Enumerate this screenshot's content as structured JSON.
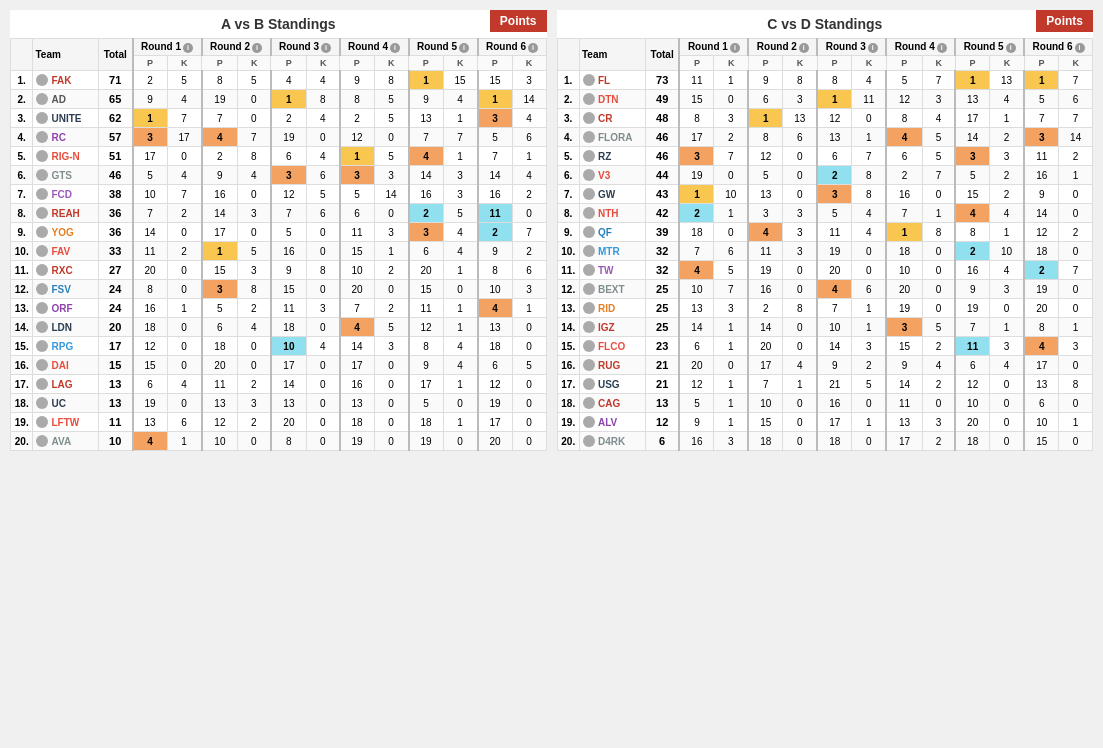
{
  "tableA": {
    "title": "A vs B Standings",
    "pointsLabel": "Points",
    "columns": {
      "rank": "#",
      "team": "Team",
      "total": "Total",
      "rounds": [
        "Round 1",
        "Round 2",
        "Round 3",
        "Round 4",
        "Round 5",
        "Round 6"
      ]
    },
    "rows": [
      {
        "rank": 1,
        "name": "FAK",
        "total": 71,
        "class": "fak",
        "r1p": 2,
        "r1k": 5,
        "r2p": 8,
        "r2k": 5,
        "r3p": 4,
        "r3k": 4,
        "r4p": 9,
        "r4k": 8,
        "r5p": 1,
        "r5k": 15,
        "r6p": 15,
        "r6k": 3,
        "highlights": {
          "r5p": "gold",
          "r5k": ""
        }
      },
      {
        "rank": 2,
        "name": "AD",
        "total": 65,
        "class": "ad",
        "r1p": 9,
        "r1k": 4,
        "r2p": 19,
        "r2k": 0,
        "r3p": 1,
        "r3k": 8,
        "r4p": 8,
        "r4k": 5,
        "r5p": 9,
        "r5k": 4,
        "r6p": 1,
        "r6k": 14,
        "highlights": {
          "r3p": "gold",
          "r6p": "gold"
        }
      },
      {
        "rank": 3,
        "name": "UNITE",
        "total": 62,
        "class": "unite",
        "r1p": 1,
        "r1k": 7,
        "r2p": 7,
        "r2k": 0,
        "r3p": 2,
        "r3k": 4,
        "r4p": 2,
        "r4k": 5,
        "r5p": 13,
        "r5k": 1,
        "r6p": 3,
        "r6k": 4,
        "highlights": {
          "r1p": "gold",
          "r6p": "orange"
        }
      },
      {
        "rank": 4,
        "name": "RC",
        "total": 57,
        "class": "rc",
        "r1p": 3,
        "r1k": 17,
        "r2p": 4,
        "r2k": 7,
        "r3p": 19,
        "r3k": 0,
        "r4p": 12,
        "r4k": 0,
        "r5p": 7,
        "r5k": 7,
        "r6p": 5,
        "r6k": 6,
        "highlights": {
          "r1p": "orange",
          "r2p": "orange"
        }
      },
      {
        "rank": 5,
        "name": "RIG-N",
        "total": 51,
        "class": "rign",
        "r1p": 17,
        "r1k": 0,
        "r2p": 2,
        "r2k": 8,
        "r3p": 6,
        "r3k": 4,
        "r4p": 1,
        "r4k": 5,
        "r5p": 4,
        "r5k": 1,
        "r6p": 7,
        "r6k": 1,
        "highlights": {
          "r4p": "gold",
          "r5p": "orange"
        }
      },
      {
        "rank": 6,
        "name": "GTS",
        "total": 46,
        "class": "gts",
        "r1p": 5,
        "r1k": 4,
        "r2p": 9,
        "r2k": 4,
        "r3p": 3,
        "r3k": 6,
        "r4p": 3,
        "r4k": 3,
        "r5p": 14,
        "r5k": 3,
        "r6p": 14,
        "r6k": 4,
        "highlights": {
          "r3p": "orange",
          "r4p": "orange"
        }
      },
      {
        "rank": 7,
        "name": "FCD",
        "total": 38,
        "class": "fcd",
        "r1p": 10,
        "r1k": 7,
        "r2p": 16,
        "r2k": 0,
        "r3p": 12,
        "r3k": 5,
        "r4p": 5,
        "r4k": 14,
        "r5p": 16,
        "r5k": 3,
        "r6p": 16,
        "r6k": 2,
        "highlights": {}
      },
      {
        "rank": 8,
        "name": "REAH",
        "total": 36,
        "class": "reah",
        "r1p": 7,
        "r1k": 2,
        "r2p": 14,
        "r2k": 3,
        "r3p": 7,
        "r3k": 6,
        "r4p": 6,
        "r4k": 0,
        "r5p": 2,
        "r5k": 5,
        "r6p": 11,
        "r6k": 0,
        "highlights": {
          "r5p": "blue",
          "r6p": "blue"
        }
      },
      {
        "rank": 9,
        "name": "YOG",
        "total": 36,
        "class": "yog",
        "r1p": 14,
        "r1k": 0,
        "r2p": 17,
        "r2k": 0,
        "r3p": 5,
        "r3k": 0,
        "r4p": 11,
        "r4k": 3,
        "r5p": 3,
        "r5k": 4,
        "r6p": 2,
        "r6k": 7,
        "highlights": {
          "r5p": "orange",
          "r6p": "blue"
        }
      },
      {
        "rank": 10,
        "name": "FAV",
        "total": 33,
        "class": "fav",
        "r1p": 11,
        "r1k": 2,
        "r2p": 1,
        "r2k": 5,
        "r3p": 16,
        "r3k": 0,
        "r4p": 15,
        "r4k": 1,
        "r5p": 6,
        "r5k": 4,
        "r6p": 9,
        "r6k": 2,
        "highlights": {
          "r2p": "gold"
        }
      },
      {
        "rank": 11,
        "name": "RXC",
        "total": 27,
        "class": "rxc",
        "r1p": 20,
        "r1k": 0,
        "r2p": 15,
        "r2k": 3,
        "r3p": 9,
        "r3k": 8,
        "r4p": 10,
        "r4k": 2,
        "r5p": 20,
        "r5k": 1,
        "r6p": 8,
        "r6k": 6,
        "highlights": {}
      },
      {
        "rank": 12,
        "name": "FSV",
        "total": 24,
        "class": "fsv",
        "r1p": 8,
        "r1k": 0,
        "r2p": 3,
        "r2k": 8,
        "r3p": 15,
        "r3k": 0,
        "r4p": 20,
        "r4k": 0,
        "r5p": 15,
        "r5k": 0,
        "r6p": 10,
        "r6k": 3,
        "highlights": {
          "r2p": "orange"
        }
      },
      {
        "rank": 13,
        "name": "ORF",
        "total": 24,
        "class": "orf",
        "r1p": 16,
        "r1k": 1,
        "r2p": 5,
        "r2k": 2,
        "r3p": 11,
        "r3k": 3,
        "r4p": 7,
        "r4k": 2,
        "r5p": 11,
        "r5k": 1,
        "r6p": 4,
        "r6k": 1,
        "highlights": {
          "r6p": "orange"
        }
      },
      {
        "rank": 14,
        "name": "LDN",
        "total": 20,
        "class": "ldn",
        "r1p": 18,
        "r1k": 0,
        "r2p": 6,
        "r2k": 4,
        "r3p": 18,
        "r3k": 0,
        "r4p": 4,
        "r4k": 5,
        "r5p": 12,
        "r5k": 1,
        "r6p": 13,
        "r6k": 0,
        "highlights": {
          "r4p": "orange"
        }
      },
      {
        "rank": 15,
        "name": "RPG",
        "total": 17,
        "class": "rpg",
        "r1p": 12,
        "r1k": 0,
        "r2p": 18,
        "r2k": 0,
        "r3p": 10,
        "r3k": 4,
        "r4p": 14,
        "r4k": 3,
        "r5p": 8,
        "r5k": 4,
        "r6p": 18,
        "r6k": 0,
        "highlights": {
          "r3p": "blue"
        }
      },
      {
        "rank": 16,
        "name": "DAI",
        "total": 15,
        "class": "dai",
        "r1p": 15,
        "r1k": 0,
        "r2p": 20,
        "r2k": 0,
        "r3p": 17,
        "r3k": 0,
        "r4p": 17,
        "r4k": 0,
        "r5p": 9,
        "r5k": 4,
        "r6p": 6,
        "r6k": 5,
        "highlights": {}
      },
      {
        "rank": 17,
        "name": "LAG",
        "total": 13,
        "class": "lag",
        "r1p": 6,
        "r1k": 4,
        "r2p": 11,
        "r2k": 2,
        "r3p": 14,
        "r3k": 0,
        "r4p": 16,
        "r4k": 0,
        "r5p": 17,
        "r5k": 1,
        "r6p": 12,
        "r6k": 0,
        "highlights": {}
      },
      {
        "rank": 18,
        "name": "UC",
        "total": 13,
        "class": "uc",
        "r1p": 19,
        "r1k": 0,
        "r2p": 13,
        "r2k": 3,
        "r3p": 13,
        "r3k": 0,
        "r4p": 13,
        "r4k": 0,
        "r5p": 5,
        "r5k": 0,
        "r6p": 19,
        "r6k": 0,
        "highlights": {}
      },
      {
        "rank": 19,
        "name": "LFTW",
        "total": 11,
        "class": "lftw",
        "r1p": 13,
        "r1k": 6,
        "r2p": 12,
        "r2k": 2,
        "r3p": 20,
        "r3k": 0,
        "r4p": 18,
        "r4k": 0,
        "r5p": 18,
        "r5k": 1,
        "r6p": 17,
        "r6k": 0,
        "highlights": {}
      },
      {
        "rank": 20,
        "name": "AVA",
        "total": 10,
        "class": "ava",
        "r1p": 4,
        "r1k": 1,
        "r2p": 10,
        "r2k": 0,
        "r3p": 8,
        "r3k": 0,
        "r4p": 19,
        "r4k": 0,
        "r5p": 19,
        "r5k": 0,
        "r6p": 20,
        "r6k": 0,
        "highlights": {
          "r1p": "orange"
        }
      }
    ]
  },
  "tableB": {
    "title": "C vs D Standings",
    "pointsLabel": "Points",
    "columns": {
      "rank": "#",
      "team": "Team",
      "total": "Total",
      "rounds": [
        "Round 1",
        "Round 2",
        "Round 3",
        "Round 4",
        "Round 5",
        "Round 6"
      ]
    },
    "rows": [
      {
        "rank": 1,
        "name": "FL",
        "total": 73,
        "class": "fak",
        "r1p": 11,
        "r1k": 1,
        "r2p": 9,
        "r2k": 8,
        "r3p": 8,
        "r3k": 4,
        "r4p": 5,
        "r4k": 7,
        "r5p": 1,
        "r5k": 13,
        "r6p": 1,
        "r6k": 7,
        "highlights": {
          "r5p": "gold",
          "r6p": "gold"
        }
      },
      {
        "rank": 2,
        "name": "DTN",
        "total": 49,
        "class": "rign",
        "r1p": 15,
        "r1k": 0,
        "r2p": 6,
        "r2k": 3,
        "r3p": 1,
        "r3k": 11,
        "r4p": 12,
        "r4k": 3,
        "r5p": 13,
        "r5k": 4,
        "r6p": 5,
        "r6k": 6,
        "highlights": {
          "r3p": "gold"
        }
      },
      {
        "rank": 3,
        "name": "CR",
        "total": 48,
        "class": "reah",
        "r1p": 8,
        "r1k": 3,
        "r2p": 1,
        "r2k": 13,
        "r3p": 12,
        "r3k": 0,
        "r4p": 8,
        "r4k": 4,
        "r5p": 17,
        "r5k": 1,
        "r6p": 7,
        "r6k": 7,
        "highlights": {
          "r2p": "gold"
        }
      },
      {
        "rank": 4,
        "name": "FLORA",
        "total": 46,
        "class": "gts",
        "r1p": 17,
        "r1k": 2,
        "r2p": 8,
        "r2k": 6,
        "r3p": 13,
        "r3k": 1,
        "r4p": 4,
        "r4k": 5,
        "r5p": 14,
        "r5k": 2,
        "r6p": 3,
        "r6k": 14,
        "highlights": {
          "r4p": "orange",
          "r6p": "orange"
        }
      },
      {
        "rank": 5,
        "name": "RZ",
        "total": 46,
        "class": "ldn",
        "r1p": 3,
        "r1k": 7,
        "r2p": 12,
        "r2k": 0,
        "r3p": 6,
        "r3k": 7,
        "r4p": 6,
        "r4k": 5,
        "r5p": 3,
        "r5k": 3,
        "r6p": 11,
        "r6k": 2,
        "highlights": {
          "r1p": "orange",
          "r5p": "orange"
        }
      },
      {
        "rank": 6,
        "name": "V3",
        "total": 44,
        "class": "fav",
        "r1p": 19,
        "r1k": 0,
        "r2p": 5,
        "r2k": 0,
        "r3p": 2,
        "r3k": 8,
        "r4p": 2,
        "r4k": 7,
        "r5p": 5,
        "r5k": 2,
        "r6p": 16,
        "r6k": 1,
        "highlights": {
          "r3p": "blue"
        }
      },
      {
        "rank": 7,
        "name": "GW",
        "total": 43,
        "class": "unite",
        "r1p": 1,
        "r1k": 10,
        "r2p": 13,
        "r2k": 0,
        "r3p": 3,
        "r3k": 8,
        "r4p": 16,
        "r4k": 0,
        "r5p": 15,
        "r5k": 2,
        "r6p": 9,
        "r6k": 0,
        "highlights": {
          "r1p": "gold",
          "r3p": "orange"
        }
      },
      {
        "rank": 8,
        "name": "NTH",
        "total": 42,
        "class": "rign",
        "r1p": 2,
        "r1k": 1,
        "r2p": 3,
        "r2k": 3,
        "r3p": 5,
        "r3k": 4,
        "r4p": 7,
        "r4k": 1,
        "r5p": 4,
        "r5k": 4,
        "r6p": 14,
        "r6k": 0,
        "highlights": {
          "r1p": "blue",
          "r5p": "orange"
        }
      },
      {
        "rank": 9,
        "name": "QF",
        "total": 39,
        "class": "fsv",
        "r1p": 18,
        "r1k": 0,
        "r2p": 4,
        "r2k": 3,
        "r3p": 11,
        "r3k": 4,
        "r4p": 1,
        "r4k": 8,
        "r5p": 8,
        "r5k": 1,
        "r6p": 12,
        "r6k": 2,
        "highlights": {
          "r2p": "orange",
          "r4p": "gold"
        }
      },
      {
        "rank": 10,
        "name": "MTR",
        "total": 32,
        "class": "rpg",
        "r1p": 7,
        "r1k": 6,
        "r2p": 11,
        "r2k": 3,
        "r3p": 19,
        "r3k": 0,
        "r4p": 18,
        "r4k": 0,
        "r5p": 2,
        "r5k": 10,
        "r6p": 18,
        "r6k": 0,
        "highlights": {
          "r5p": "blue"
        }
      },
      {
        "rank": 11,
        "name": "TW",
        "total": 32,
        "class": "fcd",
        "r1p": 4,
        "r1k": 5,
        "r2p": 19,
        "r2k": 0,
        "r3p": 20,
        "r3k": 0,
        "r4p": 10,
        "r4k": 0,
        "r5p": 16,
        "r5k": 4,
        "r6p": 2,
        "r6k": 7,
        "highlights": {
          "r1p": "orange",
          "r6p": "blue"
        }
      },
      {
        "rank": 12,
        "name": "BEXT",
        "total": 25,
        "class": "gts",
        "r1p": 10,
        "r1k": 7,
        "r2p": 16,
        "r2k": 0,
        "r3p": 4,
        "r3k": 6,
        "r4p": 20,
        "r4k": 0,
        "r5p": 9,
        "r5k": 3,
        "r6p": 19,
        "r6k": 0,
        "highlights": {
          "r3p": "orange"
        }
      },
      {
        "rank": 13,
        "name": "RID",
        "total": 25,
        "class": "yog",
        "r1p": 13,
        "r1k": 3,
        "r2p": 2,
        "r2k": 8,
        "r3p": 7,
        "r3k": 1,
        "r4p": 19,
        "r4k": 0,
        "r5p": 19,
        "r5k": 0,
        "r6p": 20,
        "r6k": 0,
        "highlights": {}
      },
      {
        "rank": 14,
        "name": "IGZ",
        "total": 25,
        "class": "lag",
        "r1p": 14,
        "r1k": 1,
        "r2p": 14,
        "r2k": 0,
        "r3p": 10,
        "r3k": 1,
        "r4p": 3,
        "r4k": 5,
        "r5p": 7,
        "r5k": 1,
        "r6p": 8,
        "r6k": 1,
        "highlights": {
          "r4p": "orange"
        }
      },
      {
        "rank": 15,
        "name": "FLCO",
        "total": 23,
        "class": "dai",
        "r1p": 6,
        "r1k": 1,
        "r2p": 20,
        "r2k": 0,
        "r3p": 14,
        "r3k": 3,
        "r4p": 15,
        "r4k": 2,
        "r5p": 11,
        "r5k": 3,
        "r6p": 4,
        "r6k": 3,
        "highlights": {
          "r5p": "blue",
          "r6p": "orange"
        }
      },
      {
        "rank": 16,
        "name": "RUG",
        "total": 21,
        "class": "reah",
        "r1p": 20,
        "r1k": 0,
        "r2p": 17,
        "r2k": 4,
        "r3p": 9,
        "r3k": 2,
        "r4p": 9,
        "r4k": 4,
        "r5p": 6,
        "r5k": 4,
        "r6p": 17,
        "r6k": 0,
        "highlights": {}
      },
      {
        "rank": 17,
        "name": "USG",
        "total": 21,
        "class": "uc",
        "r1p": 12,
        "r1k": 1,
        "r2p": 7,
        "r2k": 1,
        "r3p": 21,
        "r3k": 5,
        "r4p": 14,
        "r4k": 2,
        "r5p": 12,
        "r5k": 0,
        "r6p": 13,
        "r6k": 8,
        "highlights": {}
      },
      {
        "rank": 18,
        "name": "CAG",
        "total": 13,
        "class": "rxc",
        "r1p": 5,
        "r1k": 1,
        "r2p": 10,
        "r2k": 0,
        "r3p": 16,
        "r3k": 0,
        "r4p": 11,
        "r4k": 0,
        "r5p": 10,
        "r5k": 0,
        "r6p": 6,
        "r6k": 0,
        "highlights": {}
      },
      {
        "rank": 19,
        "name": "ALV",
        "total": 12,
        "class": "orf",
        "r1p": 9,
        "r1k": 1,
        "r2p": 15,
        "r2k": 0,
        "r3p": 17,
        "r3k": 1,
        "r4p": 13,
        "r4k": 3,
        "r5p": 20,
        "r5k": 0,
        "r6p": 10,
        "r6k": 1,
        "highlights": {}
      },
      {
        "rank": 20,
        "name": "D4RK",
        "total": 6,
        "class": "ava",
        "r1p": 16,
        "r1k": 3,
        "r2p": 18,
        "r2k": 0,
        "r3p": 18,
        "r3k": 0,
        "r4p": 17,
        "r4k": 2,
        "r5p": 18,
        "r5k": 0,
        "r6p": 15,
        "r6k": 0,
        "highlights": {}
      }
    ]
  }
}
